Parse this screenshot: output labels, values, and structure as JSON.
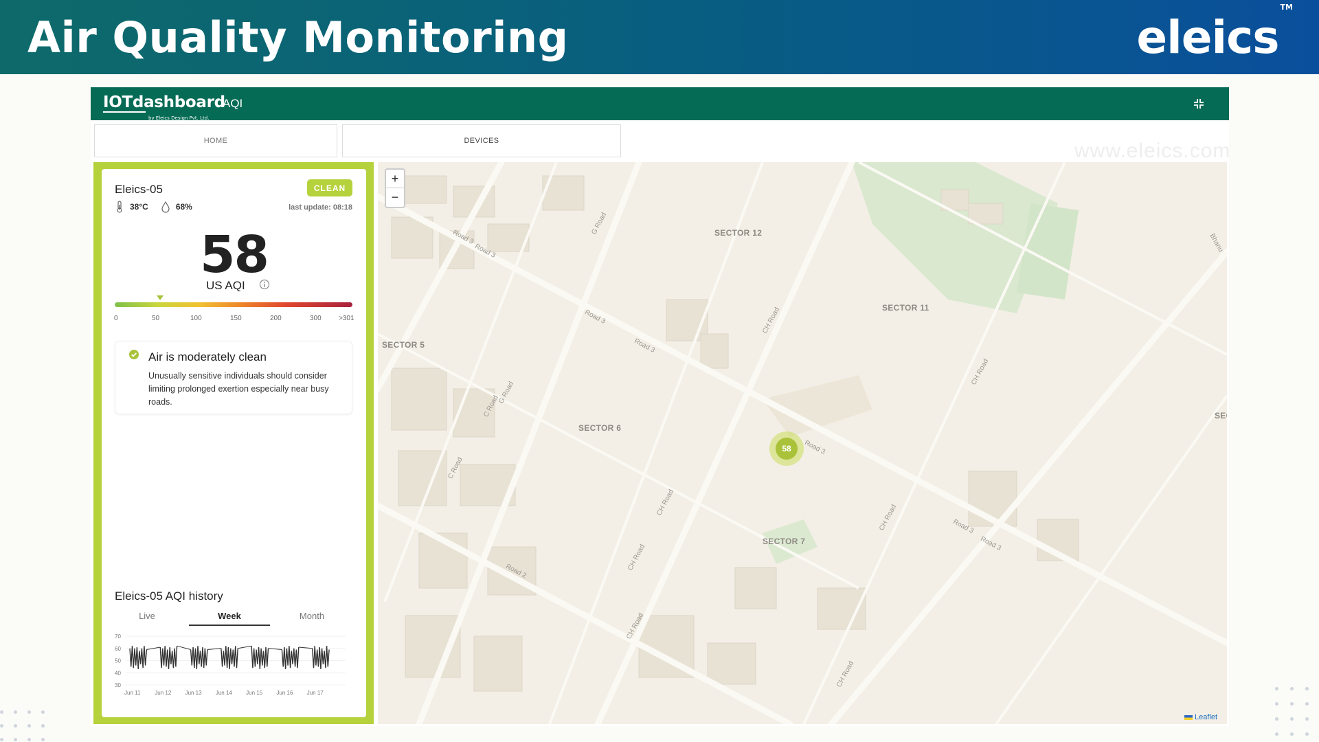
{
  "banner": {
    "title": "Air Quality Monitoring",
    "brand": "eleics",
    "brand_mark": "TM"
  },
  "topbar": {
    "logo_text": "IOTdashboard",
    "logo_subtext": "by Eleics Design Pvt. Ltd.",
    "section": "AQI",
    "expand_icon": "collapse-arrows-icon"
  },
  "nav": {
    "home": "HOME",
    "devices": "DEVICES"
  },
  "watermark": "www.eleics.com",
  "device": {
    "name": "Eleics-05",
    "status": "CLEAN",
    "temperature": "38°C",
    "humidity": "68%",
    "last_update": "last update: 08:18",
    "aqi": "58",
    "aqi_unit": "US AQI",
    "scale_labels": [
      "0",
      "50",
      "100",
      "150",
      "200",
      "300",
      ">301"
    ],
    "message_title": "Air is moderately clean",
    "message_body": "Unusually sensitive individuals should consider limiting prolonged exertion especially near busy roads."
  },
  "history": {
    "title": "Eleics-05 AQI history",
    "tabs": [
      "Live",
      "Week",
      "Month"
    ],
    "active_tab": "Week"
  },
  "chart_data": {
    "type": "line",
    "title": "",
    "xlabel": "",
    "ylabel": "",
    "ylim": [
      30,
      70
    ],
    "yticks": [
      "70",
      "60",
      "50",
      "40",
      "30"
    ],
    "x": [
      "Jun 11",
      "Jun 12",
      "Jun 13",
      "Jun 14",
      "Jun 15",
      "Jun 16",
      "Jun 17"
    ],
    "series": [
      {
        "values": [
          [
            60,
            45,
            62,
            44,
            60,
            46,
            61,
            43,
            58,
            47,
            60,
            44,
            62,
            46,
            59
          ],
          [
            61,
            44,
            60,
            46,
            62,
            45,
            59,
            43,
            61,
            47,
            58,
            44,
            60,
            45,
            62
          ],
          [
            59,
            46,
            61,
            44,
            60,
            43,
            62,
            47,
            58,
            45,
            61,
            44,
            60,
            46,
            59
          ],
          [
            60,
            45,
            58,
            46,
            62,
            44,
            61,
            43,
            60,
            47,
            59,
            45,
            62,
            44,
            60
          ],
          [
            62,
            44,
            60,
            45,
            59,
            47,
            61,
            43,
            60,
            46,
            58,
            44,
            61,
            45,
            60
          ],
          [
            59,
            45,
            61,
            43,
            60,
            46,
            62,
            44,
            58,
            47,
            60,
            45,
            59,
            44,
            61
          ],
          [
            60,
            44,
            62,
            46,
            59,
            45,
            61,
            43,
            60,
            47,
            58,
            44,
            62,
            45,
            59
          ]
        ]
      }
    ]
  },
  "map": {
    "marker_value": "58",
    "zoom_in": "+",
    "zoom_out": "−",
    "attribution": "Leaflet",
    "sectors": [
      "SECTOR 12",
      "SECTOR 11",
      "SECTOR 5",
      "SECTOR 6",
      "SECTOR 7",
      "SEC"
    ],
    "roads": [
      "Road 3",
      "Road 3",
      "Road 3",
      "Road 3",
      "G Road",
      "CH Road",
      "G Road",
      "C Road",
      "C Road",
      "CH Road",
      "CH Road",
      "CH Road",
      "Road 3",
      "Road 2",
      "Road 3",
      "Road 3",
      "CH Road",
      "CH Road",
      "CH Road",
      "Bhanu"
    ]
  }
}
